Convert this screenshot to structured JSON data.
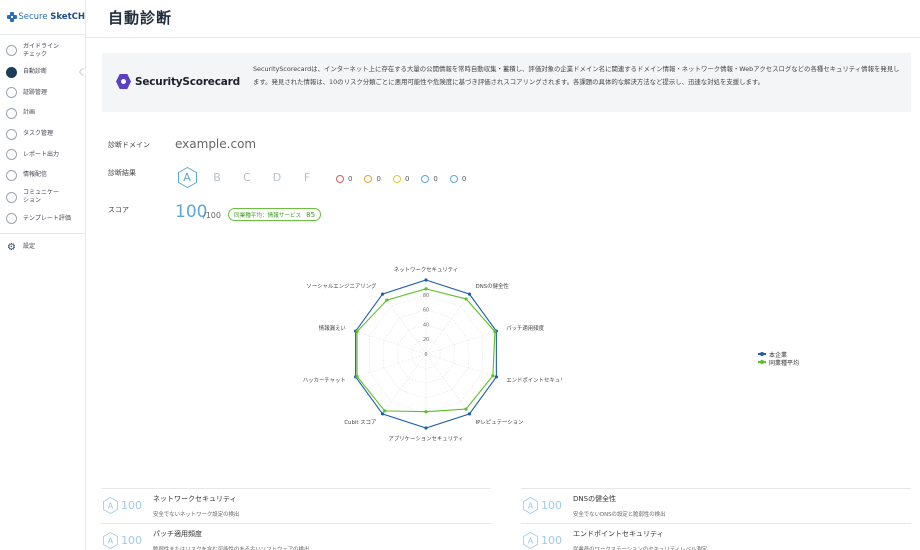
{
  "app": {
    "name_prefix": "Secure ",
    "name_suffix": "SketCH"
  },
  "sidebar": {
    "items": [
      {
        "label": "ガイドライン\nチェック",
        "icon": "guideline-icon"
      },
      {
        "label": "自動診断",
        "icon": "auto-diagnosis-icon",
        "active": true
      },
      {
        "label": "証跡管理",
        "icon": "evidence-icon"
      },
      {
        "label": "計画",
        "icon": "plan-icon"
      },
      {
        "label": "タスク管理",
        "icon": "task-icon"
      },
      {
        "label": "レポート出力",
        "icon": "report-icon"
      },
      {
        "label": "情報配信",
        "icon": "info-delivery-icon"
      },
      {
        "label": "コミュニケー\nション",
        "icon": "communication-icon"
      },
      {
        "label": "テンプレート評価",
        "icon": "template-icon"
      }
    ],
    "settings_label": "設定"
  },
  "header": {
    "title": "自動診断"
  },
  "banner": {
    "logo_text": "SecurityScorecard",
    "text": "SecurityScorecardは、インターネット上に存在する大量の公開情報を常時自動収集・蓄積し、評価対象の企業ドメイン名に関連するドメイン情報・ネットワーク情報・Webアクセスログなどの各種セキュリティ情報を発見します。発見された情報は、10のリスク分類ごとに悪用可能性や危険度に基づき評価されスコアリングされます。各課題の具体的な解決方法など提示し、迅速な対処を支援します。"
  },
  "diagnosis": {
    "domain_label": "診断ドメイン",
    "domain_value": "example.com",
    "result_label": "診断結果",
    "grades": [
      "A",
      "B",
      "C",
      "D",
      "F"
    ],
    "selected_grade": "A",
    "risk_counts": [
      {
        "icon": "critical-icon",
        "count": "0",
        "color": "#e05a5a"
      },
      {
        "icon": "high-icon",
        "count": "0",
        "color": "#e8a23a"
      },
      {
        "icon": "medium-icon",
        "count": "0",
        "color": "#e8c53a"
      },
      {
        "icon": "low-icon",
        "count": "0",
        "color": "#5aa9d6"
      },
      {
        "icon": "info-icon",
        "count": "0",
        "color": "#5aa9d6"
      }
    ],
    "score_label": "スコア",
    "score_value": "100",
    "score_max": "/100",
    "industry_label": "同業種平均：情報サービス",
    "industry_score": "85"
  },
  "chart_data": {
    "type": "radar",
    "categories": [
      "ネットワークセキュリティ",
      "DNSの健全性",
      "パッチ適用頻度",
      "エンドポイントセキュリティ",
      "IPレピュテーション",
      "アプリケーションセキュリティ",
      "Cubit スコア",
      "ハッカーチャット",
      "情報漏えい",
      "ソーシャルエンジニアリング"
    ],
    "rlim": [
      0,
      100
    ],
    "ticks": [
      "0",
      "20",
      "40",
      "60",
      "80"
    ],
    "series": [
      {
        "name": "本企業",
        "color": "#1f5fa8",
        "values": [
          100,
          100,
          100,
          100,
          100,
          100,
          100,
          100,
          100,
          100
        ]
      },
      {
        "name": "同業種平均",
        "color": "#5cc02a",
        "values": [
          88,
          92,
          98,
          95,
          92,
          78,
          95,
          98,
          98,
          90
        ]
      }
    ],
    "legend": "right"
  },
  "categories": [
    {
      "score": "100",
      "title": "ネットワークセキュリティ",
      "desc": "安全でないネットワーク設定の検出"
    },
    {
      "score": "100",
      "title": "DNSの健全性",
      "desc": "安全でないDNSの設定と脆弱性の検出"
    },
    {
      "score": "100",
      "title": "パッチ適用頻度",
      "desc": "脆弱性またはリスクを含む可能性のある古いソフトウェアの検出"
    },
    {
      "score": "100",
      "title": "エンドポイントセキュリティ",
      "desc": "従業員のワークステーションのセキュリティレベル測定"
    }
  ]
}
